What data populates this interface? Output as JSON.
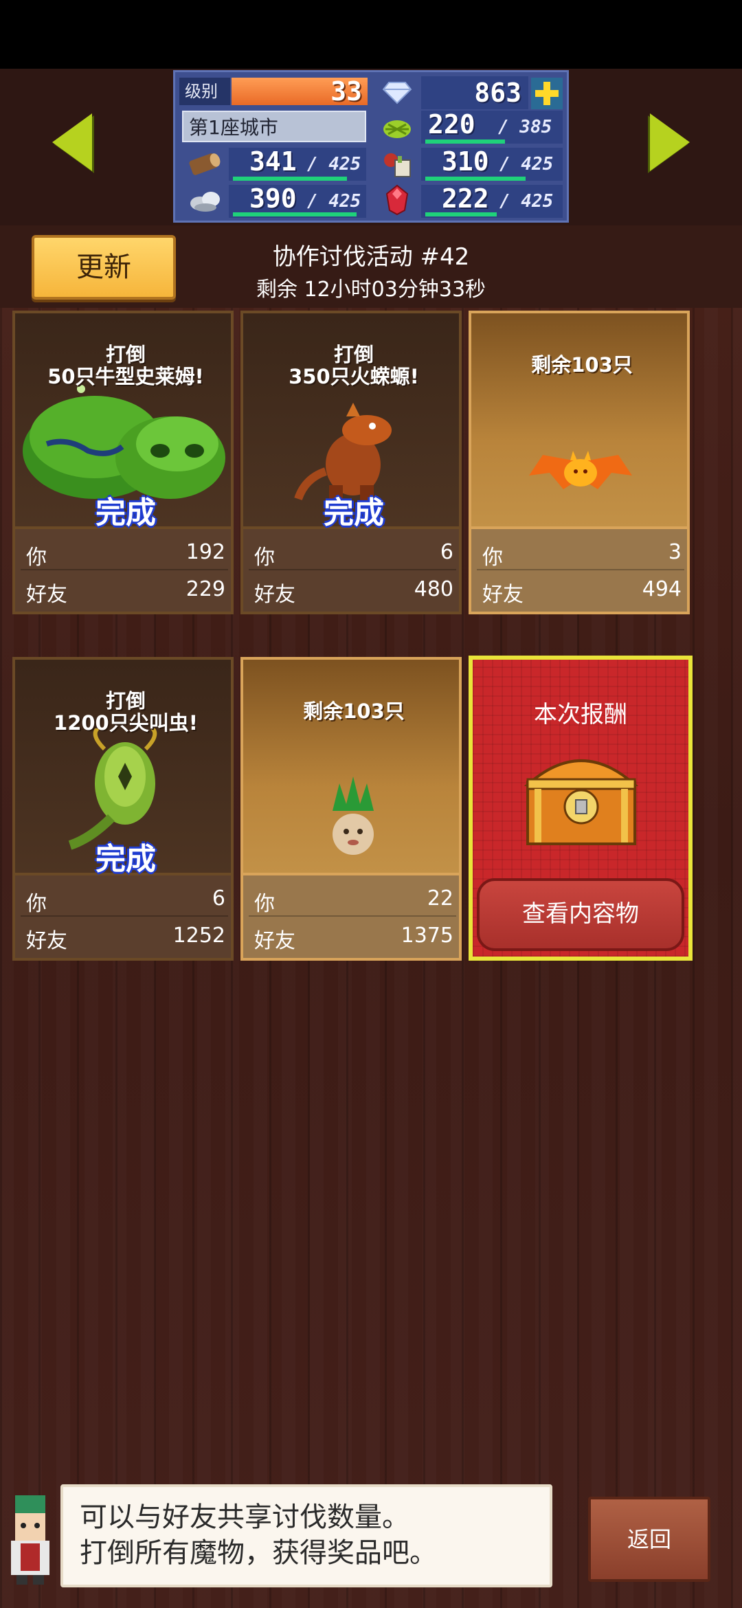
{
  "status": {
    "level_label": "级别",
    "level": "33",
    "gems": "863",
    "city": "第1座城市",
    "wood": {
      "value": "341",
      "max": "/ 425"
    },
    "food": {
      "value": "310",
      "max": "/ 425"
    },
    "stone": {
      "value": "390",
      "max": "/ 425"
    },
    "red_gem": {
      "value": "222",
      "max": "/ 425"
    },
    "grass": {
      "value": "220",
      "max": "/ 385"
    }
  },
  "header": {
    "refresh_label": "更新",
    "event_title": "协作讨伐活动 #42",
    "event_timer": "剩余 12小时03分钟33秒"
  },
  "cards": [
    {
      "title_line1": "打倒",
      "title_line2": "50只牛型史莱姆!",
      "status": "完成",
      "you_label": "你",
      "you": "192",
      "friend_label": "好友",
      "friend": "229"
    },
    {
      "title_line1": "打倒",
      "title_line2": "350只火蝾螈!",
      "status": "完成",
      "you_label": "你",
      "you": "6",
      "friend_label": "好友",
      "friend": "480"
    },
    {
      "remain": "剩余103只",
      "you_label": "你",
      "you": "3",
      "friend_label": "好友",
      "friend": "494"
    },
    {
      "title_line1": "打倒",
      "title_line2": "1200只尖叫虫!",
      "status": "完成",
      "you_label": "你",
      "you": "6",
      "friend_label": "好友",
      "friend": "1252"
    },
    {
      "remain": "剩余103只",
      "you_label": "你",
      "you": "22",
      "friend_label": "好友",
      "friend": "1375"
    }
  ],
  "reward": {
    "title": "本次报酬",
    "button": "查看内容物"
  },
  "dialog": {
    "line1": "可以与好友共享讨伐数量。",
    "line2": "打倒所有魔物，获得奖品吧。"
  },
  "back_label": "返回",
  "colors": {
    "status_bg": "#3e4f8f",
    "arrow": "#b6d21f",
    "done_outline": "#1e3bd0",
    "reward_bg": "#c9272a"
  }
}
